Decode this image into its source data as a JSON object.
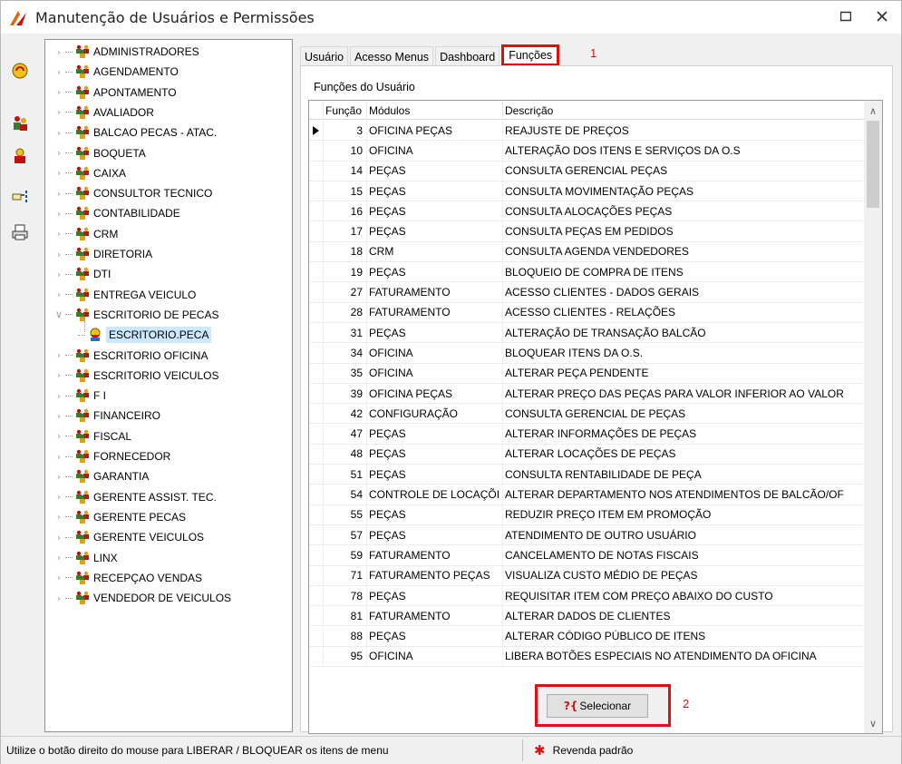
{
  "window": {
    "title": "Manutenção de Usuários e Permissões"
  },
  "tree": {
    "groups": [
      {
        "label": "ADMINISTRADORES"
      },
      {
        "label": "AGENDAMENTO"
      },
      {
        "label": "APONTAMENTO"
      },
      {
        "label": "AVALIADOR"
      },
      {
        "label": "BALCAO PECAS - ATAC."
      },
      {
        "label": "BOQUETA"
      },
      {
        "label": "CAIXA"
      },
      {
        "label": "CONSULTOR TECNICO"
      },
      {
        "label": "CONTABILIDADE"
      },
      {
        "label": "CRM"
      },
      {
        "label": "DIRETORIA"
      },
      {
        "label": "DTI"
      },
      {
        "label": "ENTREGA VEICULO"
      },
      {
        "label": "ESCRITORIO DE PECAS"
      },
      {
        "label": "ESCRITORIO.PECA"
      },
      {
        "label": "ESCRITORIO OFICINA"
      },
      {
        "label": "ESCRITORIO VEICULOS"
      },
      {
        "label": "F I"
      },
      {
        "label": "FINANCEIRO"
      },
      {
        "label": "FISCAL"
      },
      {
        "label": "FORNECEDOR"
      },
      {
        "label": "GARANTIA"
      },
      {
        "label": "GERENTE ASSIST. TEC."
      },
      {
        "label": "GERENTE PECAS"
      },
      {
        "label": "GERENTE VEICULOS"
      },
      {
        "label": "LINX"
      },
      {
        "label": "RECEPÇAO VENDAS"
      },
      {
        "label": "VENDEDOR DE VEICULOS"
      }
    ]
  },
  "tabs": [
    {
      "label": "Usuário"
    },
    {
      "label": "Acesso Menus"
    },
    {
      "label": "Dashboard"
    },
    {
      "label": "Funções"
    }
  ],
  "annotations": {
    "tab": "1",
    "button": "2"
  },
  "functions": {
    "section_label": "Funções do Usuário",
    "columns": {
      "funcao": "Função",
      "modulos": "Módulos",
      "descricao": "Descrição"
    },
    "rows": [
      {
        "funcao": "3",
        "modulos": "OFICINA PEÇAS",
        "descricao": "REAJUSTE DE PREÇOS"
      },
      {
        "funcao": "10",
        "modulos": "OFICINA",
        "descricao": "ALTERAÇÃO DOS ITENS E SERVIÇOS DA O.S"
      },
      {
        "funcao": "14",
        "modulos": "PEÇAS",
        "descricao": "CONSULTA GERENCIAL PEÇAS"
      },
      {
        "funcao": "15",
        "modulos": "PEÇAS",
        "descricao": "CONSULTA MOVIMENTAÇÃO PEÇAS"
      },
      {
        "funcao": "16",
        "modulos": "PEÇAS",
        "descricao": "CONSULTA ALOCAÇÕES PEÇAS"
      },
      {
        "funcao": "17",
        "modulos": "PEÇAS",
        "descricao": "CONSULTA PEÇAS EM PEDIDOS"
      },
      {
        "funcao": "18",
        "modulos": "CRM",
        "descricao": "CONSULTA AGENDA VENDEDORES"
      },
      {
        "funcao": "19",
        "modulos": "PEÇAS",
        "descricao": "BLOQUEIO DE COMPRA DE ITENS"
      },
      {
        "funcao": "27",
        "modulos": "FATURAMENTO",
        "descricao": "ACESSO CLIENTES - DADOS GERAIS"
      },
      {
        "funcao": "28",
        "modulos": "FATURAMENTO",
        "descricao": "ACESSO CLIENTES - RELAÇÕES"
      },
      {
        "funcao": "31",
        "modulos": "PEÇAS",
        "descricao": "ALTERAÇÃO DE TRANSAÇÃO BALCÃO"
      },
      {
        "funcao": "34",
        "modulos": "OFICINA",
        "descricao": "BLOQUEAR ITENS DA O.S."
      },
      {
        "funcao": "35",
        "modulos": "OFICINA",
        "descricao": "ALTERAR PEÇA PENDENTE"
      },
      {
        "funcao": "39",
        "modulos": "OFICINA PEÇAS",
        "descricao": "ALTERAR PREÇO DAS PEÇAS PARA VALOR INFERIOR AO VALOR"
      },
      {
        "funcao": "42",
        "modulos": "CONFIGURAÇÃO",
        "descricao": "CONSULTA GERENCIAL DE PEÇAS"
      },
      {
        "funcao": "47",
        "modulos": "PEÇAS",
        "descricao": "ALTERAR INFORMAÇÕES DE PEÇAS"
      },
      {
        "funcao": "48",
        "modulos": "PEÇAS",
        "descricao": "ALTERAR LOCAÇÕES DE PEÇAS"
      },
      {
        "funcao": "51",
        "modulos": "PEÇAS",
        "descricao": "CONSULTA RENTABILIDADE DE PEÇA"
      },
      {
        "funcao": "54",
        "modulos": "CONTROLE DE LOCAÇÕI",
        "descricao": "ALTERAR DEPARTAMENTO NOS ATENDIMENTOS DE BALCÃO/OF"
      },
      {
        "funcao": "55",
        "modulos": "PEÇAS",
        "descricao": "REDUZIR PREÇO ITEM EM PROMOÇÃO"
      },
      {
        "funcao": "57",
        "modulos": "PEÇAS",
        "descricao": "ATENDIMENTO DE OUTRO USUÁRIO"
      },
      {
        "funcao": "59",
        "modulos": "FATURAMENTO",
        "descricao": "CANCELAMENTO DE NOTAS FISCAIS"
      },
      {
        "funcao": "71",
        "modulos": "FATURAMENTO PEÇAS",
        "descricao": "VISUALIZA CUSTO MÉDIO DE PEÇAS"
      },
      {
        "funcao": "78",
        "modulos": "PEÇAS",
        "descricao": "REQUISITAR ITEM COM PREÇO ABAIXO DO CUSTO"
      },
      {
        "funcao": "81",
        "modulos": "FATURAMENTO",
        "descricao": "ALTERAR DADOS DE CLIENTES"
      },
      {
        "funcao": "88",
        "modulos": "PEÇAS",
        "descricao": "ALTERAR CÓDIGO PÚBLICO DE ITENS"
      },
      {
        "funcao": "95",
        "modulos": "OFICINA",
        "descricao": "LIBERA BOTÕES ESPECIAIS NO ATENDIMENTO DA OFICINA"
      }
    ]
  },
  "select_button": {
    "icon_glyph": "?{",
    "label": "Selecionar"
  },
  "status": {
    "left": "Utilize o botão direito do mouse para LIBERAR / BLOQUEAR os itens de menu",
    "right": "Revenda padrão"
  },
  "colors": {
    "annotation": "#e01010",
    "selection": "#cce8ff"
  }
}
